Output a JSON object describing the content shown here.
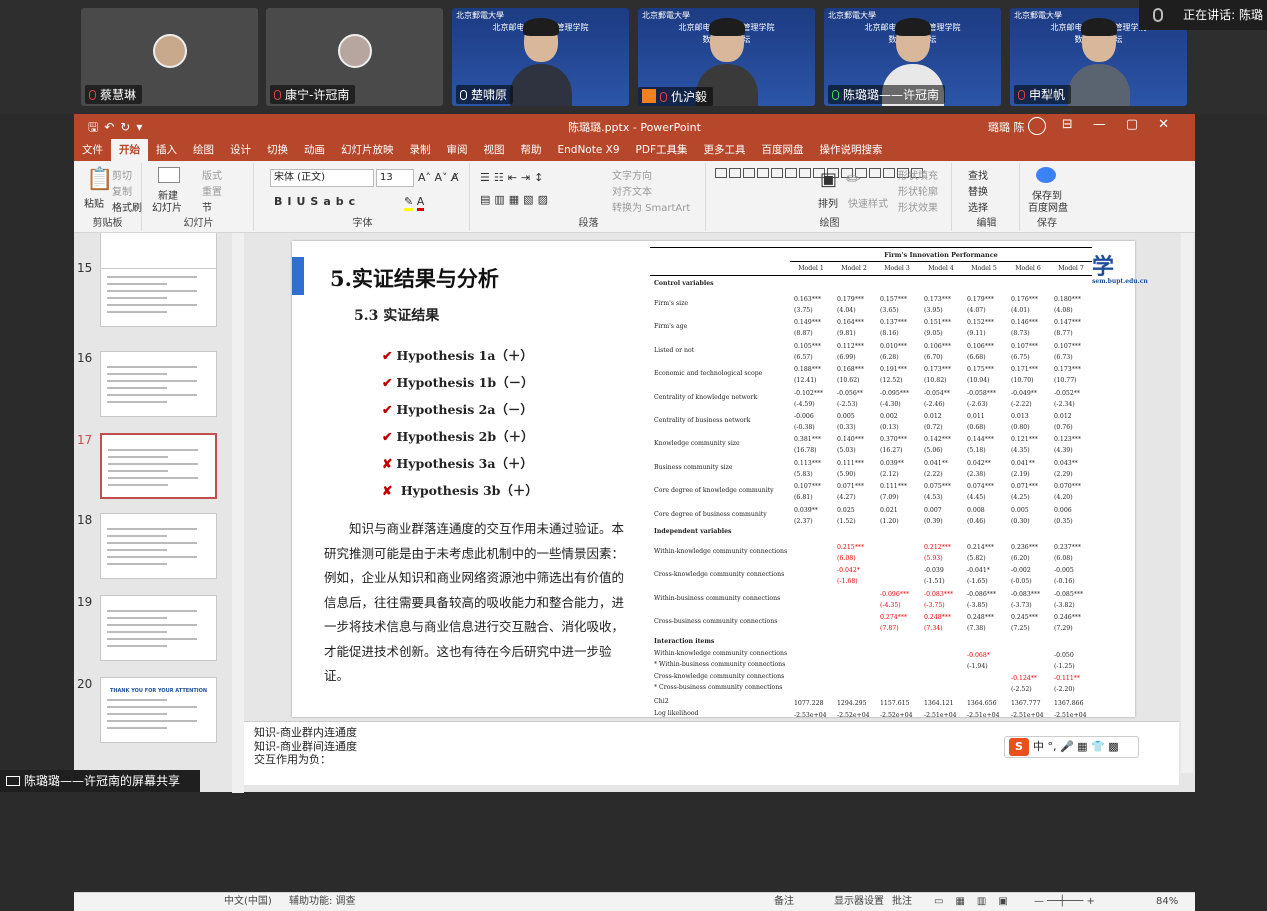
{
  "meeting": {
    "participants": [
      {
        "name": "蔡慧琳",
        "mic": "muted",
        "video": "avatar"
      },
      {
        "name": "康宁-许冠南",
        "mic": "muted",
        "video": "avatar"
      },
      {
        "name": "楚啸原",
        "mic": "on",
        "video": "camera"
      },
      {
        "name": "仇沪毅",
        "mic": "muted",
        "video": "camera"
      },
      {
        "name": "陈璐璐——许冠南",
        "mic": "speaking",
        "video": "camera"
      },
      {
        "name": "申犁帆",
        "mic": "muted",
        "video": "camera"
      }
    ],
    "banner_school": "北京邮电大学经济管理学院",
    "banner_sub": "数智社会论坛",
    "banner_logo": "北京郵電大學",
    "speaking_label": "正在讲话: 陈璐",
    "share_label": "陈璐璐——许冠南的屏幕共享"
  },
  "ppt": {
    "title": "陈璐璐.pptx - PowerPoint",
    "user": "璐璐 陈",
    "menu": [
      "文件",
      "开始",
      "插入",
      "绘图",
      "设计",
      "切换",
      "动画",
      "幻灯片放映",
      "录制",
      "审阅",
      "视图",
      "帮助",
      "EndNote X9",
      "PDF工具集",
      "更多工具",
      "百度网盘",
      "操作说明搜索"
    ],
    "ribbon": {
      "clipboard": {
        "label": "剪贴板",
        "paste": "粘贴",
        "cut": "剪切",
        "copy": "复制",
        "format": "格式刷"
      },
      "slides": {
        "label": "幻灯片",
        "new": "新建",
        "new2": "幻灯片",
        "layout": "版式",
        "reset": "重置",
        "section": "节"
      },
      "font": {
        "label": "字体",
        "name": "宋体 (正文)",
        "size": "13"
      },
      "paragraph": {
        "label": "段落",
        "textdir": "文字方向",
        "align": "对齐文本",
        "smartart": "转换为 SmartArt"
      },
      "drawing": {
        "label": "绘图",
        "arrange": "排列",
        "quickstyle": "快速样式",
        "fill": "形状填充",
        "outline": "形状轮廓",
        "effect": "形状效果"
      },
      "editing": {
        "label": "编辑",
        "find": "查找",
        "replace": "替换",
        "select": "选择"
      },
      "save": {
        "label": "保存",
        "btn1": "保存到",
        "btn2": "百度网盘"
      }
    },
    "thumbs": [
      {
        "num": "15"
      },
      {
        "num": "16"
      },
      {
        "num": "17",
        "selected": true
      },
      {
        "num": "18"
      },
      {
        "num": "19"
      },
      {
        "num": "20",
        "text": "THANK YOU FOR YOUR ATTENTION"
      }
    ],
    "slide": {
      "h1": "5.实证结果与分析",
      "h2": "5.3 实证结果",
      "hypotheses": [
        {
          "mark": "✔",
          "text": "Hypothesis 1a（＋）"
        },
        {
          "mark": "✔",
          "text": "Hypothesis 1b（－）"
        },
        {
          "mark": "✔",
          "text": "Hypothesis 2a（－）"
        },
        {
          "mark": "✔",
          "text": "Hypothesis 2b（＋）"
        },
        {
          "mark": "✘",
          "text": "Hypothesis 3a（＋）"
        },
        {
          "mark": "✘",
          "text": " Hypothesis 3b（＋）"
        }
      ],
      "paragraph": "知识与商业群落连通度的交互作用未通过验证。本研究推测可能是由于未考虑此机制中的一些情景因素：例如，企业从知识和商业网络资源池中筛选出有价值的信息后，往往需要具备较高的吸收能力和整合能力，进一步将技术信息与商业信息进行交互融合、消化吸收，才能促进技术创新。这也有待在今后研究中进一步验证。",
      "logo": "学",
      "logo_sub": "sem.bupt.edu.cn"
    },
    "table": {
      "header": "Firm's Innovation Performance",
      "models": [
        "Model 1",
        "Model 2",
        "Model 3",
        "Model 4",
        "Model 5",
        "Model 6",
        "Model 7"
      ],
      "rows": [
        {
          "label": "Control variables",
          "section": true,
          "cells": []
        },
        {
          "label": "Firm's size",
          "cells": [
            "0.163***\n(3.75)",
            "0.179***\n(4.04)",
            "0.157***\n(3.65)",
            "0.173***\n(3.95)",
            "0.179***\n(4.07)",
            "0.176***\n(4.01)",
            "0.180***\n(4.08)"
          ]
        },
        {
          "label": "Firm's age",
          "cells": [
            "0.149***\n(8.87)",
            "0.164***\n(9.81)",
            "0.137***\n(8.16)",
            "0.151***\n(9.05)",
            "0.152***\n(9.11)",
            "0.146***\n(8.73)",
            "0.147***\n(8.77)"
          ]
        },
        {
          "label": "Listed or not",
          "cells": [
            "0.105***\n(6.57)",
            "0.112***\n(6.99)",
            "0.010***\n(6.28)",
            "0.106***\n(6.70)",
            "0.106***\n(6.68)",
            "0.107***\n(6.75)",
            "0.107***\n(6.73)"
          ]
        },
        {
          "label": "Economic and technological scope",
          "cells": [
            "0.188***\n(12.41)",
            "0.168***\n(10.62)",
            "0.191***\n(12.52)",
            "0.173***\n(10.82)",
            "0.175***\n(10.94)",
            "0.171***\n(10.70)",
            "0.173***\n(10.77)"
          ]
        },
        {
          "label": "Centrality of knowledge network",
          "cells": [
            "-0.102***\n(-4.59)",
            "-0.056**\n(-2.53)",
            "-0.095***\n(-4.30)",
            "-0.054**\n(-2.46)",
            "-0.058***\n(-2.63)",
            "-0.049**\n(-2.22)",
            "-0.052**\n(-2.34)"
          ]
        },
        {
          "label": "Centrality of business network",
          "cells": [
            "-0.006\n(-0.38)",
            "0.005\n(0.33)",
            "0.002\n(0.13)",
            "0.012\n(0.72)",
            "0.011\n(0.68)",
            "0.013\n(0.80)",
            "0.012\n(0.76)"
          ]
        },
        {
          "label": "Knowledge community size",
          "cells": [
            "0.381***\n(16.78)",
            "0.140***\n(5.03)",
            "0.370***\n(16.27)",
            "0.142***\n(5.06)",
            "0.144***\n(5.18)",
            "0.121***\n(4.35)",
            "0.123***\n(4.39)"
          ]
        },
        {
          "label": "Business community size",
          "cells": [
            "0.113***\n(5.83)",
            "0.111***\n(5.90)",
            "0.039**\n(2.12)",
            "0.041**\n(2.22)",
            "0.042**\n(2.38)",
            "0.041**\n(2.19)",
            "0.043**\n(2.29)"
          ]
        },
        {
          "label": "Core degree of knowledge community",
          "cells": [
            "0.107***\n(6.81)",
            "0.071***\n(4.27)",
            "0.111***\n(7.09)",
            "0.075***\n(4.53)",
            "0.074***\n(4.45)",
            "0.071***\n(4.25)",
            "0.070***\n(4.20)"
          ]
        },
        {
          "label": "Core degree of business community",
          "cells": [
            "0.039**\n(2.37)",
            "0.025\n(1.52)",
            "0.021\n(1.20)",
            "0.007\n(0.39)",
            "0.008\n(0.46)",
            "0.005\n(0.30)",
            "0.006\n(0.35)"
          ]
        },
        {
          "label": "Independent variables",
          "section": true,
          "cells": []
        },
        {
          "label": "Within-knowledge community connections",
          "cells": [
            "",
            "0.215***\n(6.08)",
            "",
            "0.212***\n(5.93)",
            "0.214***\n(5.82)",
            "0.236***\n(6.20)",
            "0.237***\n(6.08)"
          ],
          "red": [
            1,
            3
          ]
        },
        {
          "label": "Cross-knowledge community connections",
          "cells": [
            "",
            "-0.042*\n(-1.68)",
            "",
            "-0.039\n(-1.51)",
            "-0.041*\n(-1.65)",
            "-0.002\n(-0.05)",
            "-0.005\n(-0.16)"
          ],
          "red": [
            1
          ]
        },
        {
          "label": "Within-business community connections",
          "cells": [
            "",
            "",
            "-0.096***\n(-4.35)",
            "-0.083***\n(-3.75)",
            "-0.086***\n(-3.85)",
            "-0.083***\n(-3.73)",
            "-0.085***\n(-3.82)"
          ],
          "red": [
            2,
            3
          ]
        },
        {
          "label": "Cross-business community connections",
          "cells": [
            "",
            "",
            "0.274***\n(7.87)",
            "0.248***\n(7.34)",
            "0.248***\n(7.38)",
            "0.245***\n(7.25)",
            "0.246***\n(7.29)"
          ],
          "red": [
            2,
            3
          ]
        }
      ],
      "interaction_title": "Interaction items",
      "interaction": [
        {
          "label": "Within-knowledge community connections",
          "cells": [
            "",
            "",
            "",
            "",
            "-0.068*",
            "",
            "-0.050"
          ],
          "red": [
            4
          ]
        },
        {
          "label": "* Within-business community connections",
          "cells": [
            "",
            "",
            "",
            "",
            "(-1.94)",
            "",
            "(-1.25)"
          ]
        },
        {
          "label": "Cross-knowledge community connections",
          "cells": [
            "",
            "",
            "",
            "",
            "",
            "-0.124**",
            "-0.111**"
          ],
          "red": [
            5,
            6
          ]
        },
        {
          "label": "* Cross-business community connections",
          "cells": [
            "",
            "",
            "",
            "",
            "",
            "(-2.52)",
            "(-2.20)"
          ]
        }
      ],
      "chi2": {
        "label": "Chi2",
        "cells": [
          "1077.228",
          "1294.295",
          "1157.615",
          "1364.121",
          "1364.656",
          "1367.777",
          "1367.866"
        ]
      },
      "loglik": {
        "label": "Log likelihood",
        "cells": [
          "-2.53e+04",
          "-2.52e+04",
          "-2.52e+04",
          "-2.51e+04",
          "-2.51e+04",
          "-2.51e+04",
          "-2.51e+04"
        ]
      }
    },
    "notes": [
      "知识-商业群内连通度",
      "知识-商业群间连通度",
      "交互作用为负："
    ],
    "sogou": "中 °, 🎤 ▦ 👕 ▩",
    "status": {
      "lang": "中文(中国)",
      "access": "辅助功能: 调查",
      "notes": "备注",
      "display": "显示器设置",
      "comments": "批注",
      "zoom": "84%"
    }
  }
}
